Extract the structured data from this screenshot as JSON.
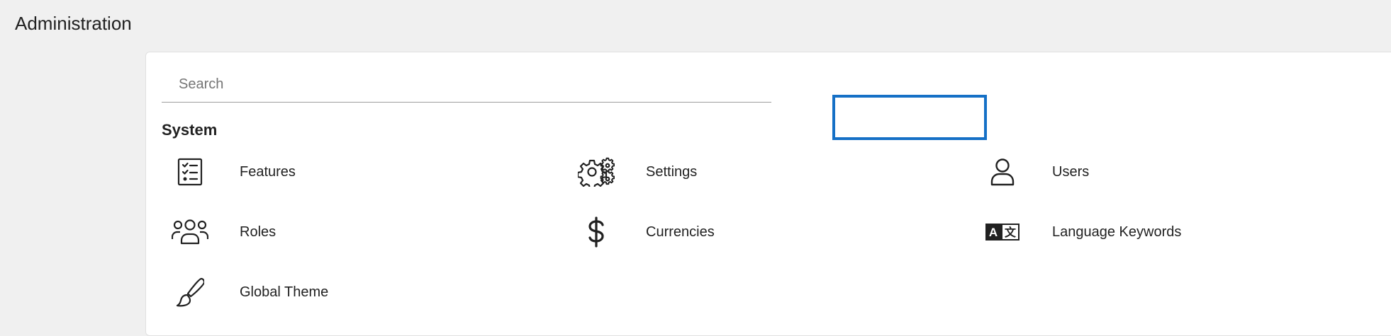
{
  "header": {
    "title": "Administration"
  },
  "search": {
    "placeholder": "Search",
    "value": ""
  },
  "section": {
    "title": "System"
  },
  "items": [
    {
      "label": "Features",
      "icon": "checklist-icon"
    },
    {
      "label": "Settings",
      "icon": "gears-icon"
    },
    {
      "label": "Users",
      "icon": "user-icon"
    },
    {
      "label": "Roles",
      "icon": "group-icon"
    },
    {
      "label": "Currencies",
      "icon": "dollar-icon"
    },
    {
      "label": "Language Keywords",
      "icon": "translate-icon"
    },
    {
      "label": "Global Theme",
      "icon": "brush-icon"
    }
  ],
  "annotation": {
    "highlight_color": "#1570c6",
    "arrow_target": "Users"
  }
}
